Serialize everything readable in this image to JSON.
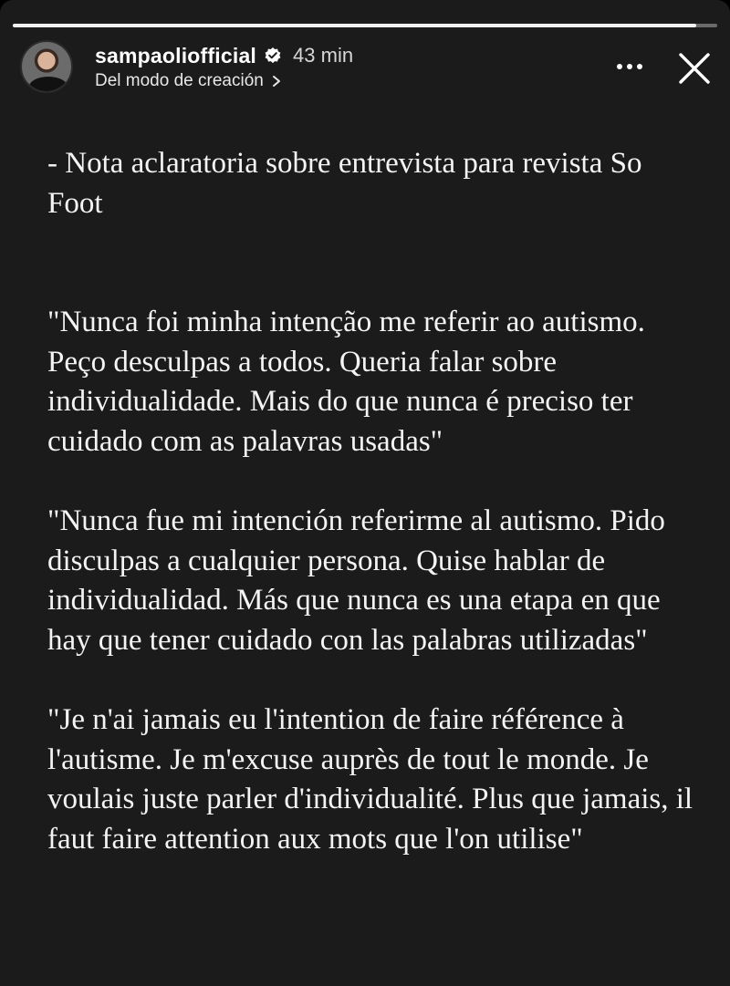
{
  "story": {
    "progress_fraction": 0.97,
    "background_color": "#1b1b1b"
  },
  "header": {
    "username": "sampaoliofficial",
    "verified_icon": "verified-badge-icon",
    "time_ago": "43 min",
    "source_label": "Del modo de creación",
    "more_icon": "more-options-icon",
    "close_icon": "close-icon"
  },
  "content": {
    "note": "- Nota aclaratoria sobre entrevista para revista So Foot",
    "quote_pt": "\"Nunca foi minha intenção me referir ao autismo. Peço desculpas a todos. Queria falar sobre individualidade. Mais do que nunca é preciso ter cuidado com as palavras usadas\"",
    "quote_es": "\"Nunca fue mi intención referirme al autismo. Pido disculpas a cualquier persona. Quise hablar de individualidad. Más que nunca es una etapa en que hay que tener cuidado con las palabras utilizadas\"",
    "quote_fr": "\"Je n'ai jamais eu l'intention de faire référence à l'autisme. Je m'excuse auprès de tout le monde. Je voulais juste parler d'individualité. Plus que jamais, il faut faire attention aux mots que l'on utilise\""
  }
}
